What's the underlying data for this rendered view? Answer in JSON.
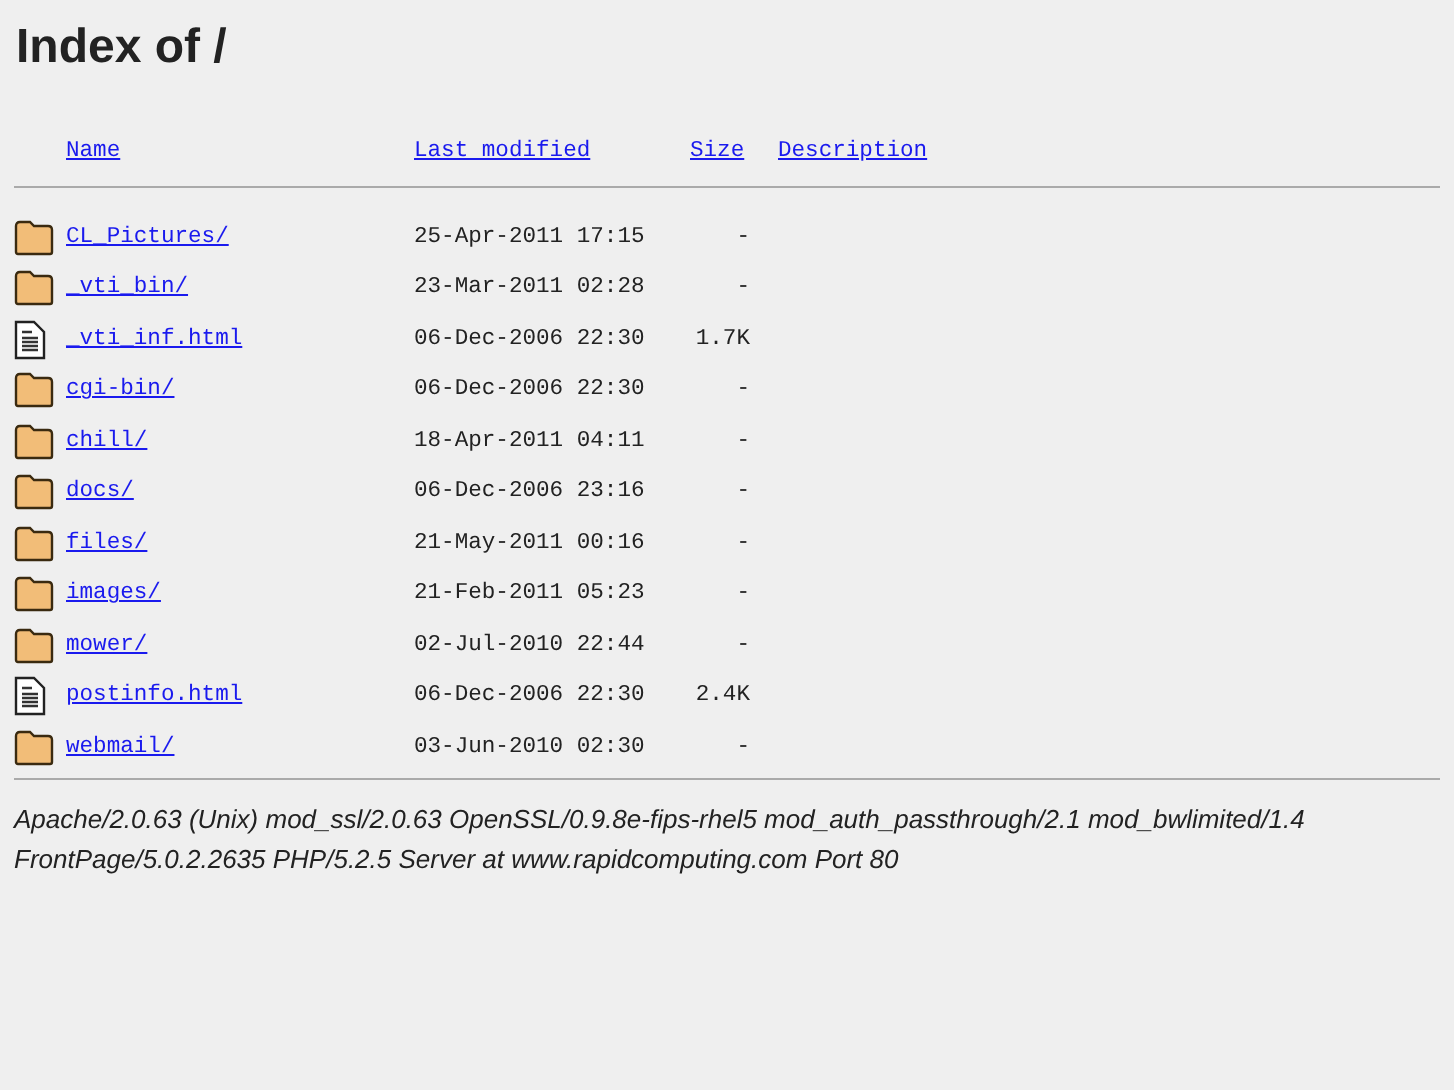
{
  "title": "Index of /",
  "columns": [
    "Name",
    "Last modified",
    "Size",
    "Description"
  ],
  "rows": [
    {
      "kind": "folder",
      "name": "CL_Pictures/",
      "modified": "25-Apr-2011 17:15",
      "size": "-"
    },
    {
      "kind": "folder",
      "name": "_vti_bin/",
      "modified": "23-Mar-2011 02:28",
      "size": "-"
    },
    {
      "kind": "file",
      "name": "_vti_inf.html",
      "modified": "06-Dec-2006 22:30",
      "size": "1.7K"
    },
    {
      "kind": "folder",
      "name": "cgi-bin/",
      "modified": "06-Dec-2006 22:30",
      "size": "-"
    },
    {
      "kind": "folder",
      "name": "chill/",
      "modified": "18-Apr-2011 04:11",
      "size": "-"
    },
    {
      "kind": "folder",
      "name": "docs/",
      "modified": "06-Dec-2006 23:16",
      "size": "-"
    },
    {
      "kind": "folder",
      "name": "files/",
      "modified": "21-May-2011 00:16",
      "size": "-"
    },
    {
      "kind": "folder",
      "name": "images/",
      "modified": "21-Feb-2011 05:23",
      "size": "-"
    },
    {
      "kind": "folder",
      "name": "mower/",
      "modified": "02-Jul-2010 22:44",
      "size": "-"
    },
    {
      "kind": "file",
      "name": "postinfo.html",
      "modified": "06-Dec-2006 22:30",
      "size": "2.4K"
    },
    {
      "kind": "folder",
      "name": "webmail/",
      "modified": "03-Jun-2010 02:30",
      "size": "-"
    }
  ],
  "footer": "Apache/2.0.63 (Unix) mod_ssl/2.0.63 OpenSSL/0.9.8e-fips-rhel5 mod_auth_passthrough/2.1 mod_bwlimited/1.4 FrontPage/5.0.2.2635 PHP/5.2.5 Server at www.rapidcomputing.com Port 80"
}
